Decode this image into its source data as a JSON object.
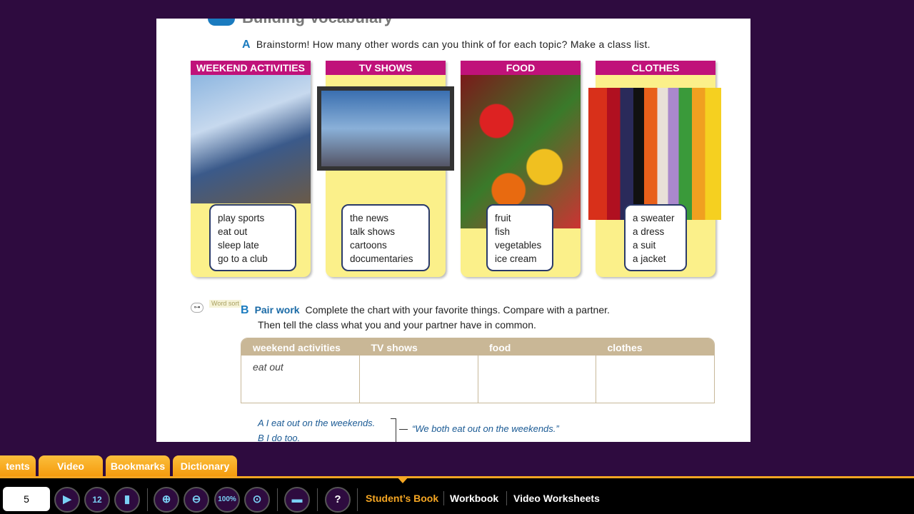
{
  "page": {
    "section_title": "Building Vocabulary",
    "exercise_a": {
      "letter": "A",
      "text": "Brainstorm! How many other words can you think of for each topic? Make a class list."
    },
    "cards": [
      {
        "title": "WEEKEND ACTIVITIES",
        "words": [
          "play sports",
          "eat out",
          "sleep late",
          "go to a club"
        ]
      },
      {
        "title": "TV SHOWS",
        "words": [
          "the news",
          "talk shows",
          "cartoons",
          "documentaries"
        ]
      },
      {
        "title": "FOOD",
        "words": [
          "fruit",
          "fish",
          "vegetables",
          "ice cream"
        ]
      },
      {
        "title": "CLOTHES",
        "words": [
          "a sweater",
          "a dress",
          "a suit",
          "a jacket"
        ]
      }
    ],
    "word_sort": "Word sort",
    "exercise_b": {
      "letter": "B",
      "label": "Pair work",
      "line1": "Complete the chart with your favorite things. Compare with a partner.",
      "line2": "Then tell the class what you and your partner have in common."
    },
    "table": {
      "headers": [
        "weekend activities",
        "TV shows",
        "food",
        "clothes"
      ],
      "row": [
        "eat out",
        "",
        "",
        ""
      ]
    },
    "conversation": {
      "a": "A  I eat out on the weekends.",
      "b": "B  I do too.",
      "conclusion": "“We both eat out on the weekends.”"
    }
  },
  "tabs": [
    "tents",
    "Video",
    "Bookmarks",
    "Dictionary"
  ],
  "toolbar": {
    "page_number": "5",
    "zoom_100": "100%",
    "help": "?",
    "links": [
      "Student’s Book",
      "Workbook",
      "Video Worksheets"
    ],
    "active_link": "Student’s Book"
  },
  "colors": {
    "background": "#2e0b3f",
    "card_header": "#c0127a",
    "card_body": "#fbf08a",
    "accent": "#f5a623",
    "table_header": "#c9b796"
  }
}
